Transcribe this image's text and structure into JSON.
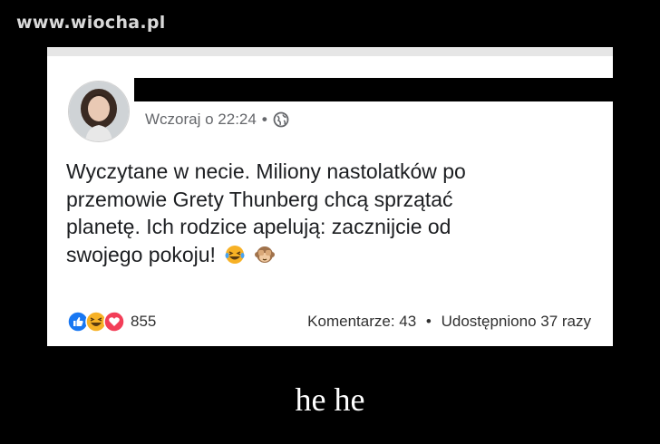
{
  "watermark": "www.wiocha.pl",
  "post": {
    "timestamp": "Wczoraj o 22:24",
    "separator": "•",
    "privacy_icon": "globe-icon",
    "text_lines": [
      "Wyczytane w necie. Miliony nastolatków po",
      "przemowie Grety Thunberg chcą sprzątać",
      "planetę. Ich rodzice apelują: zacznijcie od",
      "swojego pokoju!"
    ],
    "text_emojis": [
      "laughing-tears-emoji",
      "see-no-evil-monkey-emoji"
    ],
    "reactions": {
      "icons": [
        "like-icon",
        "haha-icon",
        "love-icon"
      ],
      "count": "855"
    },
    "comments_label": "Komentarze: 43",
    "stats_separator": "•",
    "shares_label": "Udostępniono 37 razy"
  },
  "caption": "he he",
  "colors": {
    "background": "#000000",
    "card": "#ffffff",
    "meta_text": "#65676b",
    "like_blue": "#1877f2",
    "love_red": "#f33e58",
    "haha_yellow": "#f7b125"
  }
}
